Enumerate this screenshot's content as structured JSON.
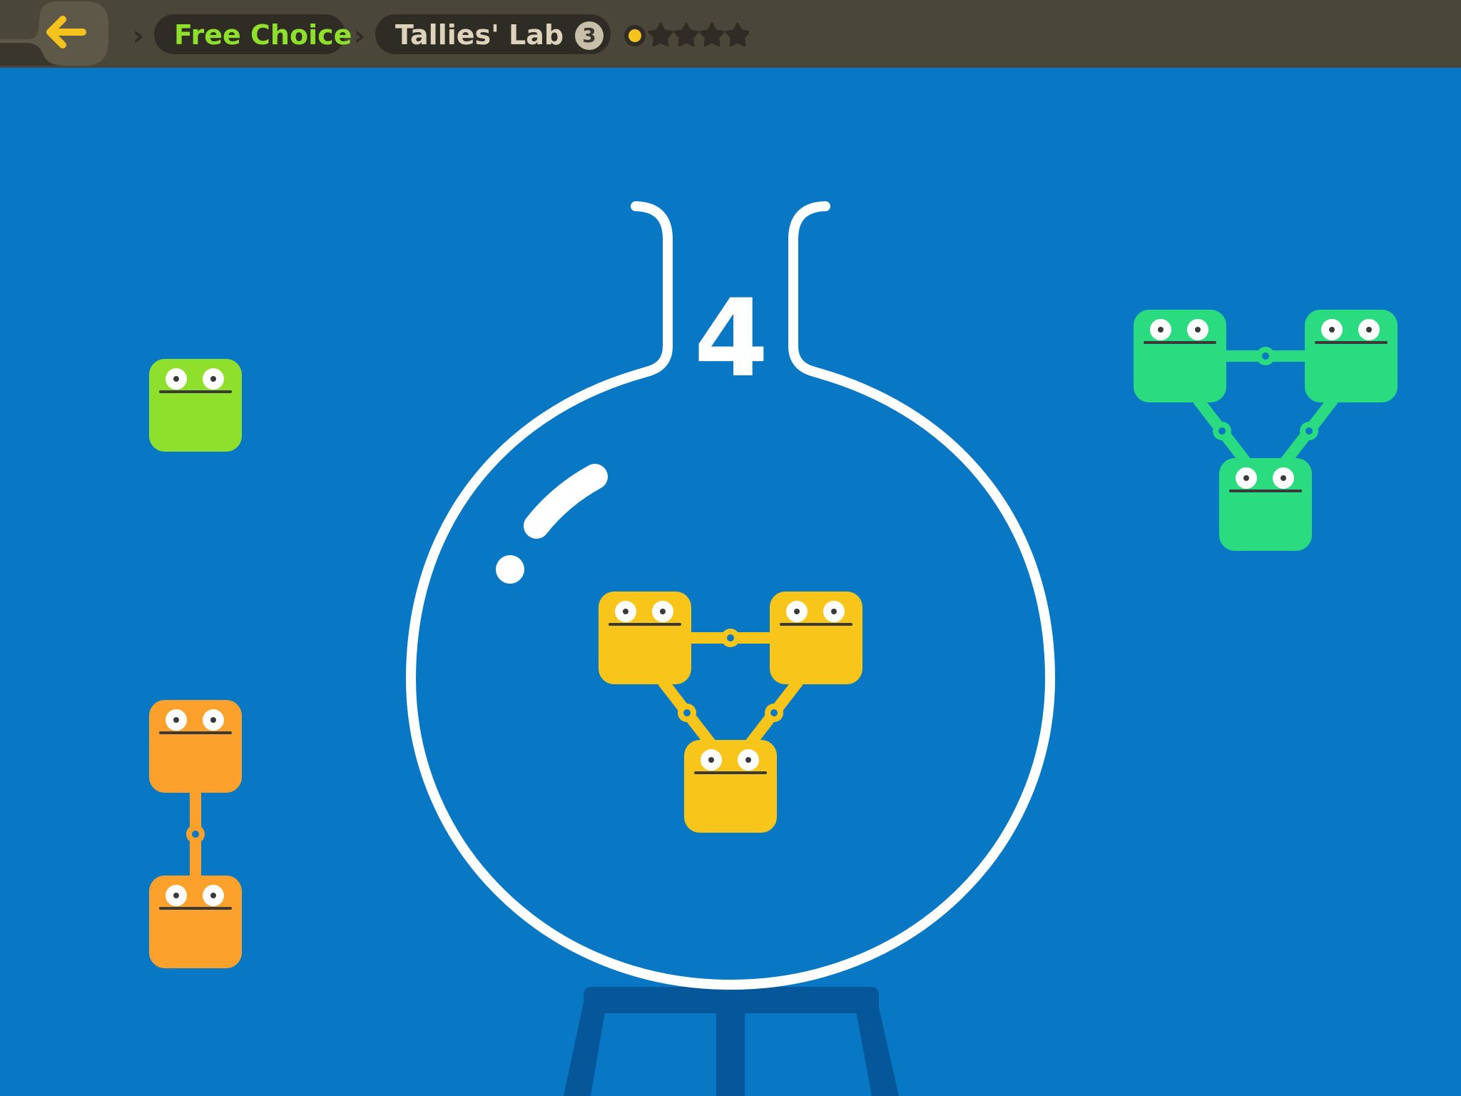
{
  "topbar": {
    "back_button": {
      "icon": "arrow-left-icon",
      "color": "#f6c21c"
    },
    "breadcrumbs": [
      {
        "label": "Free Choice",
        "color": "#8fe02c"
      },
      {
        "label": "Tallies' Lab",
        "color": "#ddd3bd"
      }
    ],
    "level": "3",
    "stars": {
      "earned": 1,
      "total": 5,
      "icon": "star-icon"
    }
  },
  "flask": {
    "count": "4",
    "contents": {
      "color": "#f8c61a",
      "blocks": 3,
      "shape": "triangle"
    }
  },
  "palette": [
    {
      "name": "green-single",
      "color": "#8fe02c",
      "blocks": 1
    },
    {
      "name": "orange-pair",
      "color": "#fba12c",
      "blocks": 2
    },
    {
      "name": "teal-triple",
      "color": "#2adb7f",
      "blocks": 3
    }
  ]
}
